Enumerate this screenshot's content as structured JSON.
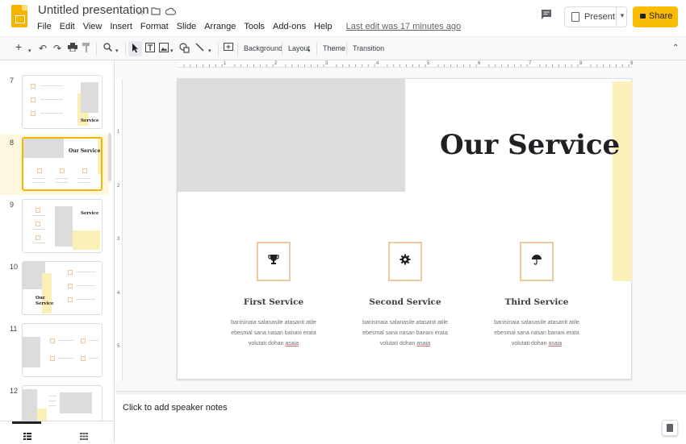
{
  "header": {
    "doc_title": "Untitled presentation",
    "menu": [
      "File",
      "Edit",
      "View",
      "Insert",
      "Format",
      "Slide",
      "Arrange",
      "Tools",
      "Add-ons",
      "Help"
    ],
    "last_edit": "Last edit was 17 minutes ago",
    "present_label": "Present",
    "share_label": "Share",
    "icons": [
      "star-icon",
      "move-to-folder-icon",
      "cloud-status-icon",
      "comment-icon",
      "present-icon",
      "lock-icon"
    ]
  },
  "toolbar": {
    "background_label": "Background",
    "layout_label": "Layout",
    "theme_label": "Theme",
    "transition_label": "Transition",
    "zoom_glyph": "🔍"
  },
  "filmstrip": {
    "slides": [
      {
        "number": "7",
        "title": "Service"
      },
      {
        "number": "8",
        "title": "Our Service"
      },
      {
        "number": "9",
        "title": "Service"
      },
      {
        "number": "10",
        "title": "Our Service"
      },
      {
        "number": "11",
        "title": ""
      },
      {
        "number": "12",
        "title": ""
      }
    ],
    "selected": "8"
  },
  "rulers": {
    "h_numbers": [
      "1",
      "2",
      "3",
      "4",
      "5",
      "6",
      "7",
      "8",
      "9"
    ],
    "v_numbers": [
      "1",
      "2",
      "3",
      "4",
      "5"
    ]
  },
  "slide": {
    "title": "Our Service",
    "services": [
      {
        "icon": "trophy-icon",
        "glyph": "🏆",
        "title": "First Service",
        "line1": "banisinaia salanasile atasanit atile",
        "line2": "ebesmal sana nasan banani erata",
        "line3a": "volutati dohan ",
        "line3b": "asaia"
      },
      {
        "icon": "gear-icon",
        "glyph": "⚙",
        "title": "Second Service",
        "line1": "banisinaia salanasile atasanit atile",
        "line2": "ebesmal sana nasan banani erata",
        "line3a": "volutati dohan ",
        "line3b": "asaia"
      },
      {
        "icon": "umbrella-icon",
        "glyph": "☂",
        "title": "Third Service",
        "line1": "banisinaia salanasile atasanit atile",
        "line2": "ebesmal sana nasan banani erata",
        "line3a": "volutati dohan ",
        "line3b": "asaia"
      }
    ]
  },
  "notes": {
    "placeholder": "Click to add speaker notes"
  },
  "colors": {
    "accent_yellow": "#fbbc04",
    "slide_yellow": "#fcf1b8",
    "icon_border": "#f0c8a0",
    "placeholder_gray": "#dcdcdc"
  }
}
